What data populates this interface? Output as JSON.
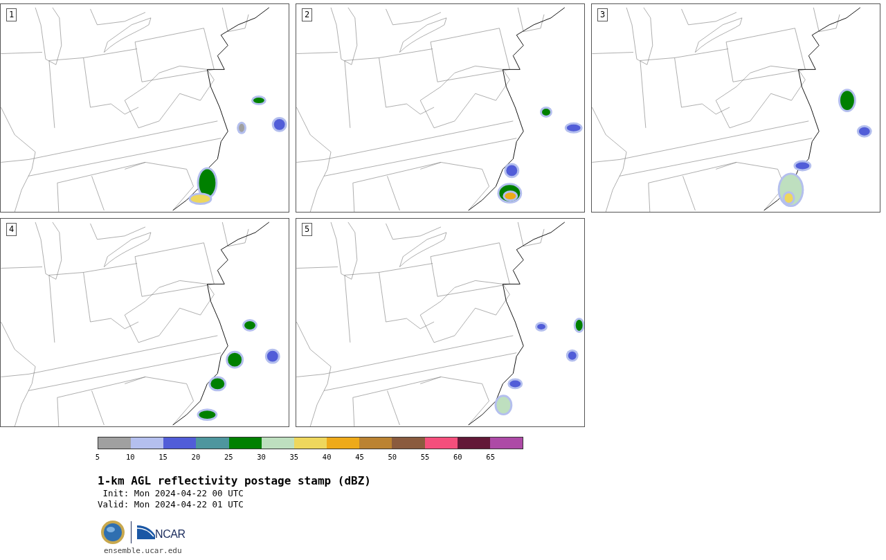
{
  "panels": [
    {
      "label": "1"
    },
    {
      "label": "2"
    },
    {
      "label": "3"
    },
    {
      "label": "4"
    },
    {
      "label": "5"
    }
  ],
  "colorbar": {
    "bins": [
      {
        "color": "#a0a0a0"
      },
      {
        "color": "#b4bfee"
      },
      {
        "color": "#515dd8"
      },
      {
        "color": "#4e969e"
      },
      {
        "color": "#008000"
      },
      {
        "color": "#bedfbf"
      },
      {
        "color": "#eed75d"
      },
      {
        "color": "#eeaa1a"
      },
      {
        "color": "#bb8332"
      },
      {
        "color": "#8a5b3e"
      },
      {
        "color": "#f44f7c"
      },
      {
        "color": "#631938"
      },
      {
        "color": "#ad4aa6"
      }
    ],
    "ticks": [
      "5",
      "10",
      "15",
      "20",
      "25",
      "30",
      "35",
      "40",
      "45",
      "50",
      "55",
      "60",
      "65"
    ]
  },
  "title": "1-km AGL reflectivity postage stamp (dBZ)",
  "init": " Init: Mon 2024-04-22 00 UTC",
  "valid": "Valid: Mon 2024-04-22 01 UTC",
  "logo_text": "NCAR",
  "url": "ensemble.ucar.edu"
}
